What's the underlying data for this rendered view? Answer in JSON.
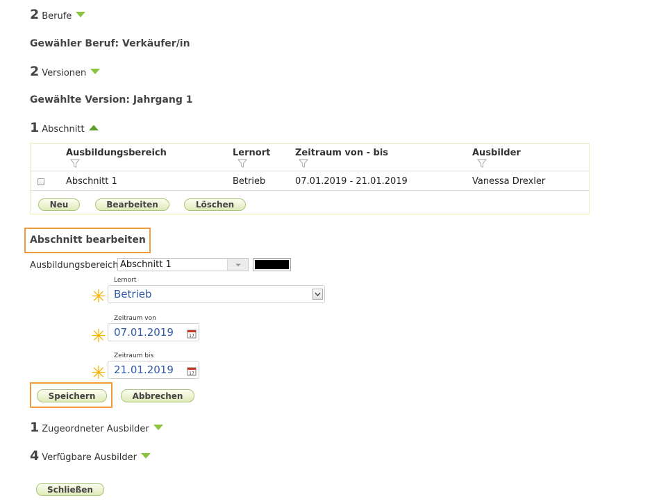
{
  "berufe": {
    "count": "2",
    "label": "Berufe"
  },
  "selected_beruf": "Gewähler Beruf: Verkäufer/in",
  "versionen": {
    "count": "2",
    "label": "Versionen"
  },
  "selected_version": "Gewählte Version: Jahrgang 1",
  "abschnitt": {
    "count": "1",
    "label": "Abschnitt"
  },
  "table": {
    "headers": [
      "Ausbildungsbereich",
      "Lernort",
      "Zeitraum von - bis",
      "Ausbilder"
    ],
    "rows": [
      {
        "ausbildungsbereich": "Abschnitt 1",
        "lernort": "Betrieb",
        "zeitraum": "07.01.2019 - 21.01.2019",
        "ausbilder": "Vanessa Drexler"
      }
    ],
    "buttons": {
      "neu": "Neu",
      "bearbeiten": "Bearbeiten",
      "loeschen": "Löschen"
    }
  },
  "edit": {
    "title": "Abschnitt bearbeiten",
    "ausbildungsbereich_label": "Ausbildungsbereich",
    "ausbildungsbereich_value": "Abschnitt 1",
    "lernort_label": "Lernort",
    "lernort_value": "Betrieb",
    "zeitraum_von_label": "Zeitraum von",
    "zeitraum_von_value": "07.01.2019",
    "zeitraum_bis_label": "Zeitraum bis",
    "zeitraum_bis_value": "21.01.2019",
    "save": "Speichern",
    "cancel": "Abbrechen",
    "color_swatch": "#000000"
  },
  "zugeordneter": {
    "count": "1",
    "label": "Zugeordneter Ausbilder"
  },
  "verfuegbare": {
    "count": "4",
    "label": "Verfügbare Ausbilder"
  },
  "close": "Schließen",
  "colors": {
    "accent_green": "#8ac43f",
    "highlight_orange": "#f29a38",
    "required_star": "#f6b400",
    "value_blue": "#2e5aa8"
  }
}
